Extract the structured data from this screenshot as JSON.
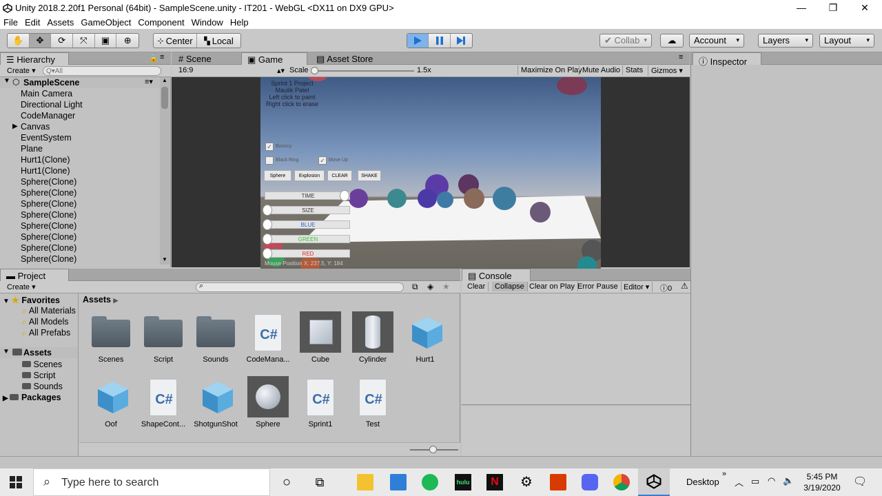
{
  "window": {
    "title": "Unity 2018.2.20f1 Personal (64bit) - SampleScene.unity - IT201 - WebGL <DX11 on DX9 GPU>",
    "minimize": "—",
    "restore": "❐",
    "close": "✕"
  },
  "menu": [
    "File",
    "Edit",
    "Assets",
    "GameObject",
    "Component",
    "Window",
    "Help"
  ],
  "toolbar": {
    "center_label": "Center",
    "local_label": "Local",
    "collab_label": "Collab",
    "account_label": "Account",
    "layers_label": "Layers",
    "layout_label": "Layout"
  },
  "hierarchy": {
    "tab": "Hierarchy",
    "create": "Create",
    "search_placeholder": "Q▾All",
    "scene": "SampleScene",
    "items": [
      "Main Camera",
      "Directional Light",
      "CodeManager",
      "Canvas",
      "EventSystem",
      "Plane",
      "Hurt1(Clone)",
      "Hurt1(Clone)",
      "Sphere(Clone)",
      "Sphere(Clone)",
      "Sphere(Clone)",
      "Sphere(Clone)",
      "Sphere(Clone)",
      "Sphere(Clone)",
      "Sphere(Clone)",
      "Sphere(Clone)"
    ]
  },
  "center_tabs": {
    "scene": "Scene",
    "game": "Game",
    "asset_store": "Asset Store"
  },
  "game_bar": {
    "aspect": "16:9",
    "scale_label": "Scale",
    "scale_value": "1.5x",
    "scale_fraction": 0.0,
    "maximize": "Maximize On Play",
    "mute": "Mute Audio",
    "stats": "Stats",
    "gizmos": "Gizmos"
  },
  "game_view": {
    "info_lines": [
      "Sprint 1 Project",
      "Maulik Patel",
      "Left click to paint",
      "Right click to erase"
    ],
    "toggle1": "Bouncy",
    "toggle2": "Black Ring",
    "toggle3": "Move Up",
    "buttons": [
      "Sphere",
      "Explosion",
      "CLEAR",
      "SHAKE"
    ],
    "sliders": [
      {
        "label": "TIME",
        "value": 1.0,
        "color": "#333333"
      },
      {
        "label": "SIZE",
        "value": 0.0,
        "color": "#333333"
      },
      {
        "label": "BLUE",
        "value": 0.0,
        "color": "#2a5fd1"
      },
      {
        "label": "GREEN",
        "value": 0.0,
        "color": "#33c933"
      },
      {
        "label": "RED",
        "value": 0.0,
        "color": "#e02424"
      }
    ],
    "mouse_position": "Mouse Position X: 237.5, Y: 184"
  },
  "inspector": {
    "tab": "Inspector"
  },
  "project": {
    "tab": "Project",
    "create": "Create",
    "favorites": "Favorites",
    "favorite_items": [
      "All Materials",
      "All Models",
      "All Prefabs"
    ],
    "assets_root": "Assets",
    "asset_folders": [
      "Scenes",
      "Script",
      "Sounds"
    ],
    "packages": "Packages",
    "breadcrumb": "Assets",
    "assets": [
      {
        "name": "Scenes",
        "kind": "folder"
      },
      {
        "name": "Script",
        "kind": "folder"
      },
      {
        "name": "Sounds",
        "kind": "folder"
      },
      {
        "name": "CodeMana...",
        "kind": "cs"
      },
      {
        "name": "Cube",
        "kind": "cube-thumb"
      },
      {
        "name": "Cylinder",
        "kind": "cylinder"
      },
      {
        "name": "Hurt1",
        "kind": "prefab"
      },
      {
        "name": "Oof",
        "kind": "prefab"
      },
      {
        "name": "ShapeCont...",
        "kind": "cs"
      },
      {
        "name": "ShotgunShot",
        "kind": "prefab"
      },
      {
        "name": "Sphere",
        "kind": "sphere"
      },
      {
        "name": "Sprint1",
        "kind": "cs"
      },
      {
        "name": "Test",
        "kind": "cs"
      }
    ],
    "cs_glyph": "C#"
  },
  "console": {
    "tab": "Console",
    "buttons": [
      "Clear",
      "Collapse",
      "Clear on Play",
      "Error Pause",
      "Editor"
    ],
    "info_count": "0"
  },
  "taskbar": {
    "search_placeholder": "Type here to search",
    "desktop": "Desktop",
    "time": "5:45 PM",
    "date": "3/19/2020"
  },
  "colors": {
    "play_active": "#3a8ee8",
    "panel": "#c2c2c2",
    "tab_bar": "#a5a5a5"
  }
}
